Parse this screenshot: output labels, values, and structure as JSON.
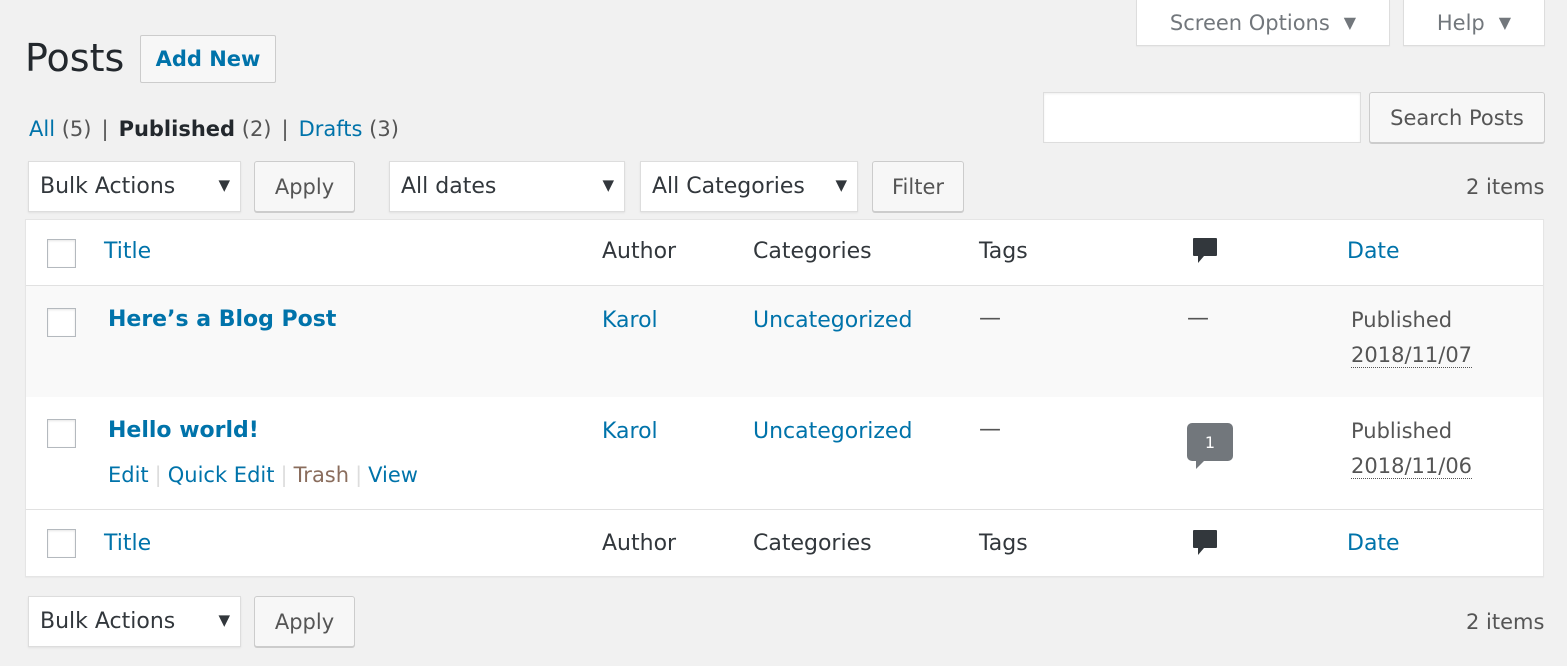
{
  "tabs": {
    "screen_options": "Screen Options",
    "help": "Help"
  },
  "header": {
    "title": "Posts",
    "add_new": "Add New"
  },
  "views": {
    "all_label": "All",
    "all_count": "(5)",
    "published_label": "Published",
    "published_count": "(2)",
    "drafts_label": "Drafts",
    "drafts_count": "(3)",
    "separator": "|"
  },
  "search": {
    "placeholder": "",
    "button": "Search Posts"
  },
  "filters": {
    "bulk_actions": "Bulk Actions",
    "apply": "Apply",
    "dates": "All dates",
    "categories": "All Categories",
    "filter": "Filter",
    "items_count": "2 items"
  },
  "table": {
    "columns": {
      "title": "Title",
      "author": "Author",
      "categories": "Categories",
      "tags": "Tags",
      "comments_icon": "comment-icon",
      "date": "Date"
    },
    "rows": [
      {
        "title": "Here’s a Blog Post",
        "author": "Karol",
        "categories": "Uncategorized",
        "tags": "—",
        "comments": "—",
        "date_status": "Published",
        "date": "2018/11/07"
      },
      {
        "title": "Hello world!",
        "author": "Karol",
        "categories": "Uncategorized",
        "tags": "—",
        "comments": "1",
        "date_status": "Published",
        "date": "2018/11/06",
        "actions": {
          "edit": "Edit",
          "quick_edit": "Quick Edit",
          "trash": "Trash",
          "view": "View"
        }
      }
    ]
  },
  "bottom": {
    "bulk_actions": "Bulk Actions",
    "apply": "Apply",
    "items_count": "2 items"
  },
  "colors": {
    "link": "#0073aa",
    "background": "#f1f1f1",
    "bubble": "#72777c"
  }
}
